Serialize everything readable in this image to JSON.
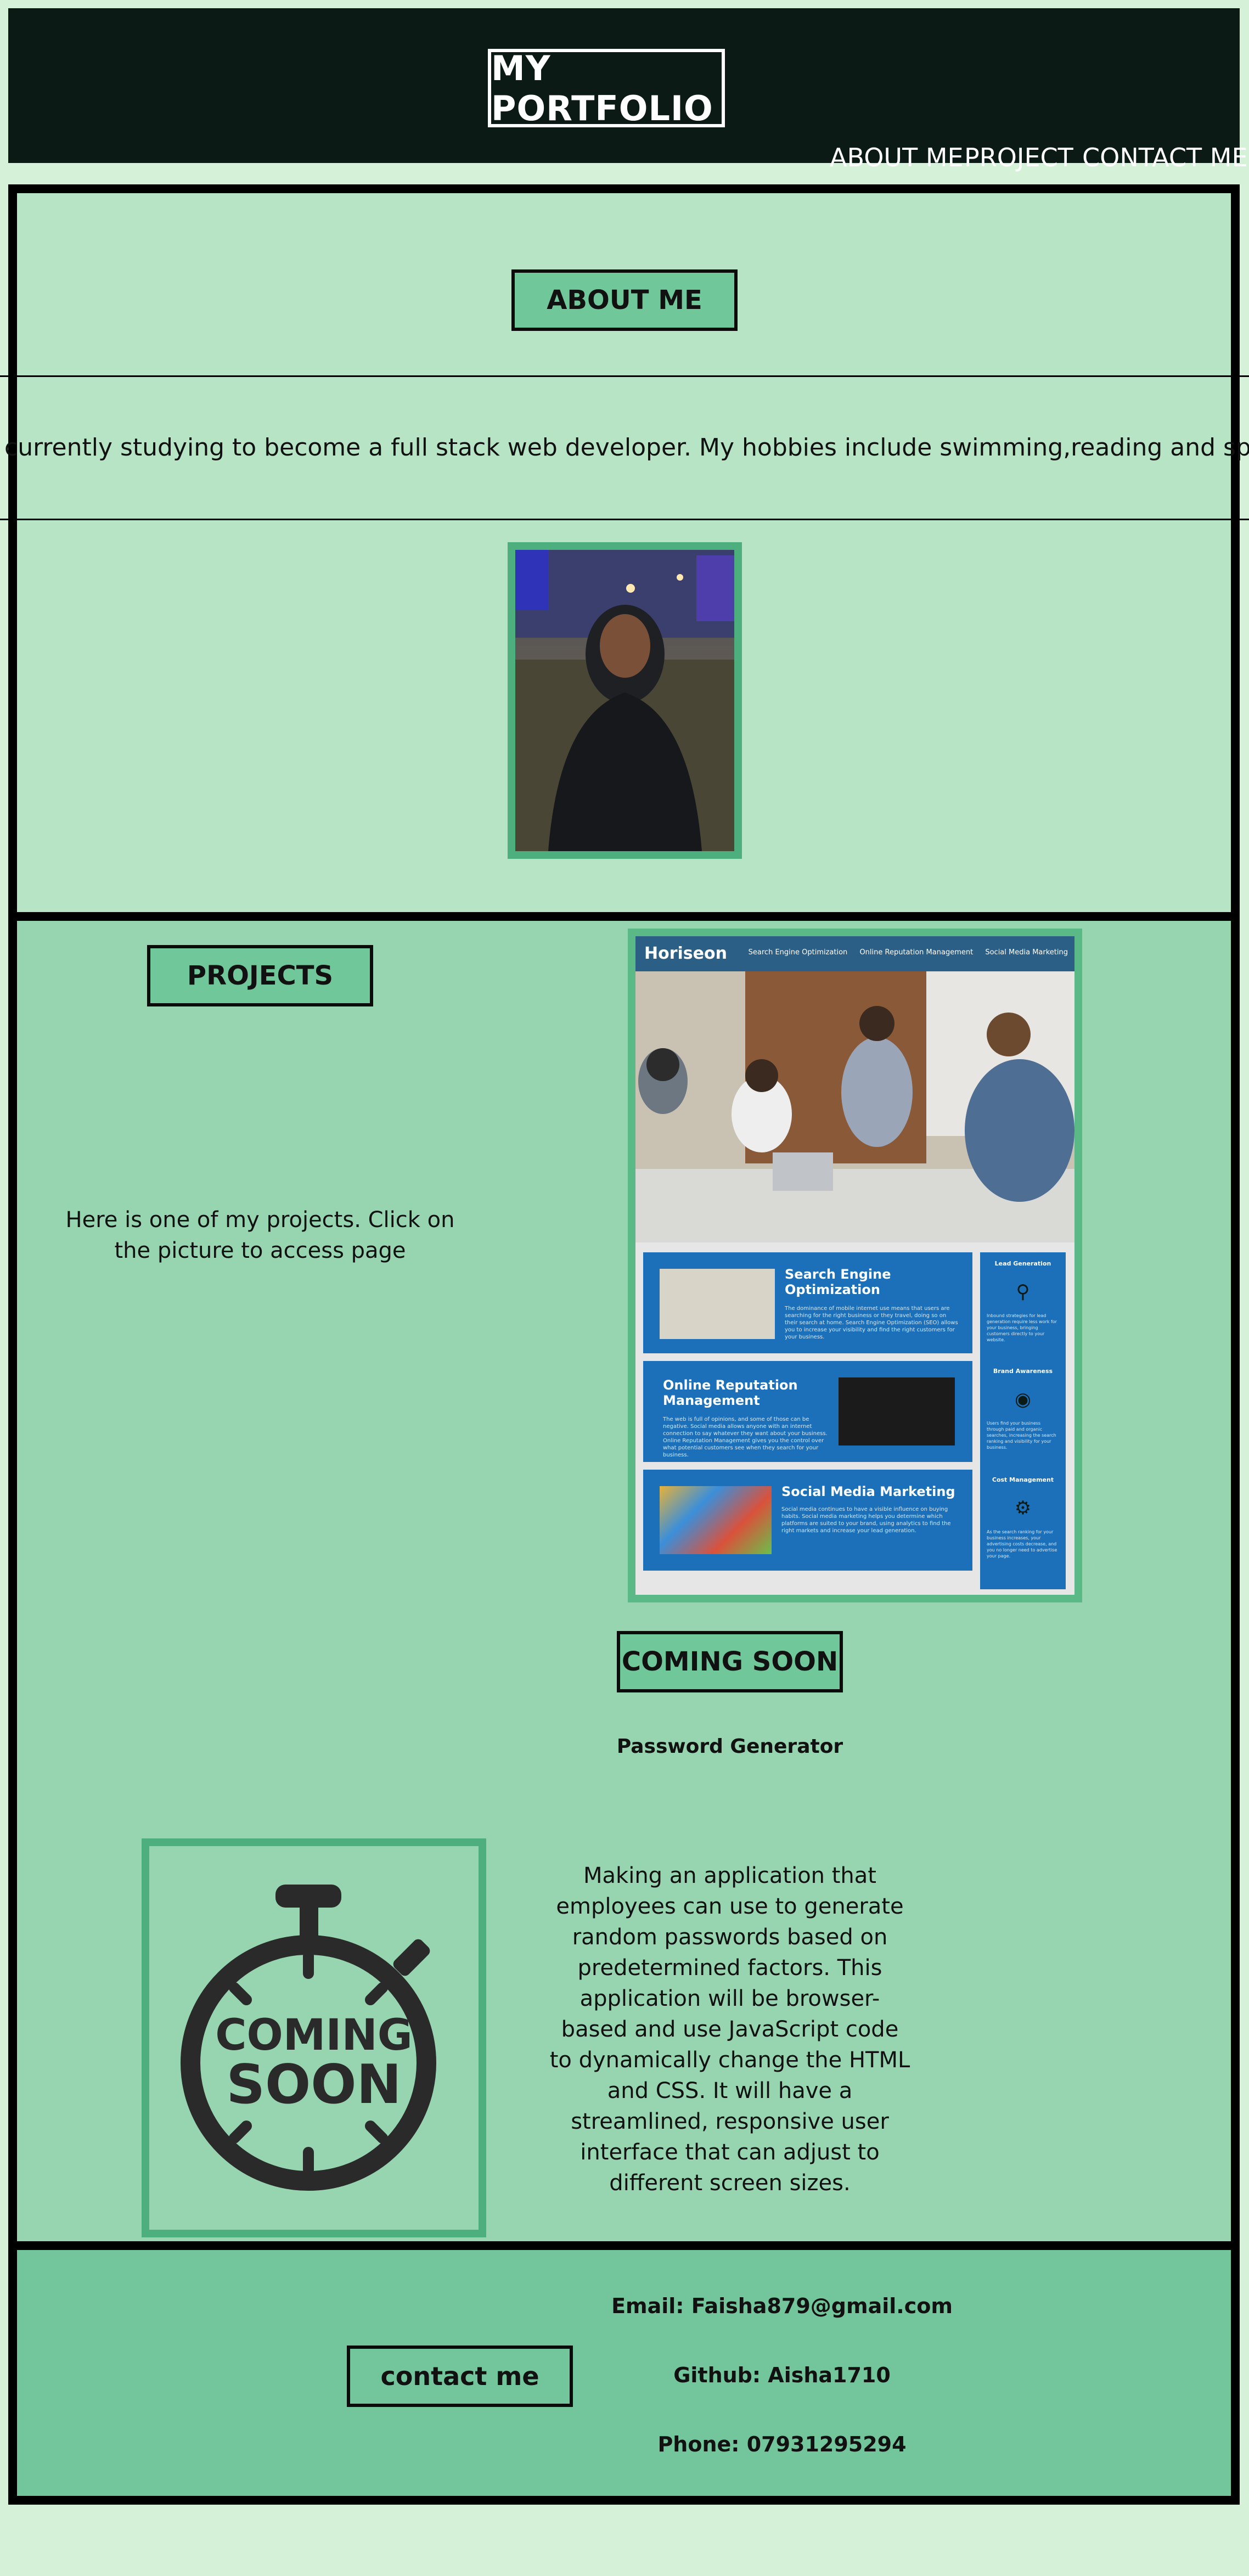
{
  "header": {
    "logo": "MY PORTFOLIO",
    "nav": [
      "ABOUT ME",
      "PROJECT",
      "CONTACT ME"
    ]
  },
  "about": {
    "heading": "ABOUT ME",
    "bio": "currently studying to become a full stack web developer. My hobbies include swimming,reading and spending time with family."
  },
  "projects": {
    "heading": "PROJECTS",
    "description": "Here is one of my projects. Click on the picture to access page",
    "screenshot": {
      "brand": "Horiseon",
      "nav": [
        "Search Engine Optimization",
        "Online Reputation Management",
        "Social Media Marketing"
      ],
      "cards": [
        {
          "title": "Search Engine Optimization",
          "text": "The dominance of mobile internet use means that users are searching for the right business or they travel, doing so on their search at home. Search Engine Optimization (SEO) allows you to increase your visibility and find the right customers for your business."
        },
        {
          "title": "Online Reputation Management",
          "text": "The web is full of opinions, and some of those can be negative. Social media allows anyone with an internet connection to say whatever they want about your business. Online Reputation Management gives you the control over what potential customers see when they search for your business."
        },
        {
          "title": "Social Media Marketing",
          "text": "Social media continues to have a visible influence on buying habits. Social media marketing helps you determine which platforms are suited to your brand, using analytics to find the right markets and increase your lead generation."
        }
      ],
      "side": [
        {
          "title": "Lead Generation",
          "text": "Inbound strategies for lead generation require less work for your business, bringing customers directly to your website."
        },
        {
          "title": "Brand Awareness",
          "text": "Users find your business through paid and organic searches, increasing the search ranking and visibility for your business."
        },
        {
          "title": "Cost Management",
          "text": "As the search ranking for your business increases, your advertising costs decrease, and you no longer need to advertise your page."
        }
      ]
    },
    "coming_soon_heading": "COMING SOON",
    "coming_title": "Password Generator",
    "coming_badge_line1": "COMING",
    "coming_badge_line2": "SOON",
    "coming_description": "Making an application that employees can use to generate random passwords based on predetermined factors. This application will be browser-based and use JavaScript code to dynamically change the HTML and CSS. It will have a streamlined, responsive user interface that can adjust to different screen sizes."
  },
  "contact": {
    "button": "contact me",
    "email": "Email: Faisha879@gmail.com",
    "github": "Github: Aisha1710",
    "phone": "Phone: 07931295294"
  },
  "colors": {
    "header_bg": "#0b1a15",
    "page_bg": "#d5f2d9",
    "about_bg": "#b6e4c5",
    "projects_bg": "#97d5b1",
    "contact_bg": "#73c69c",
    "accent": "#4caf7d"
  }
}
